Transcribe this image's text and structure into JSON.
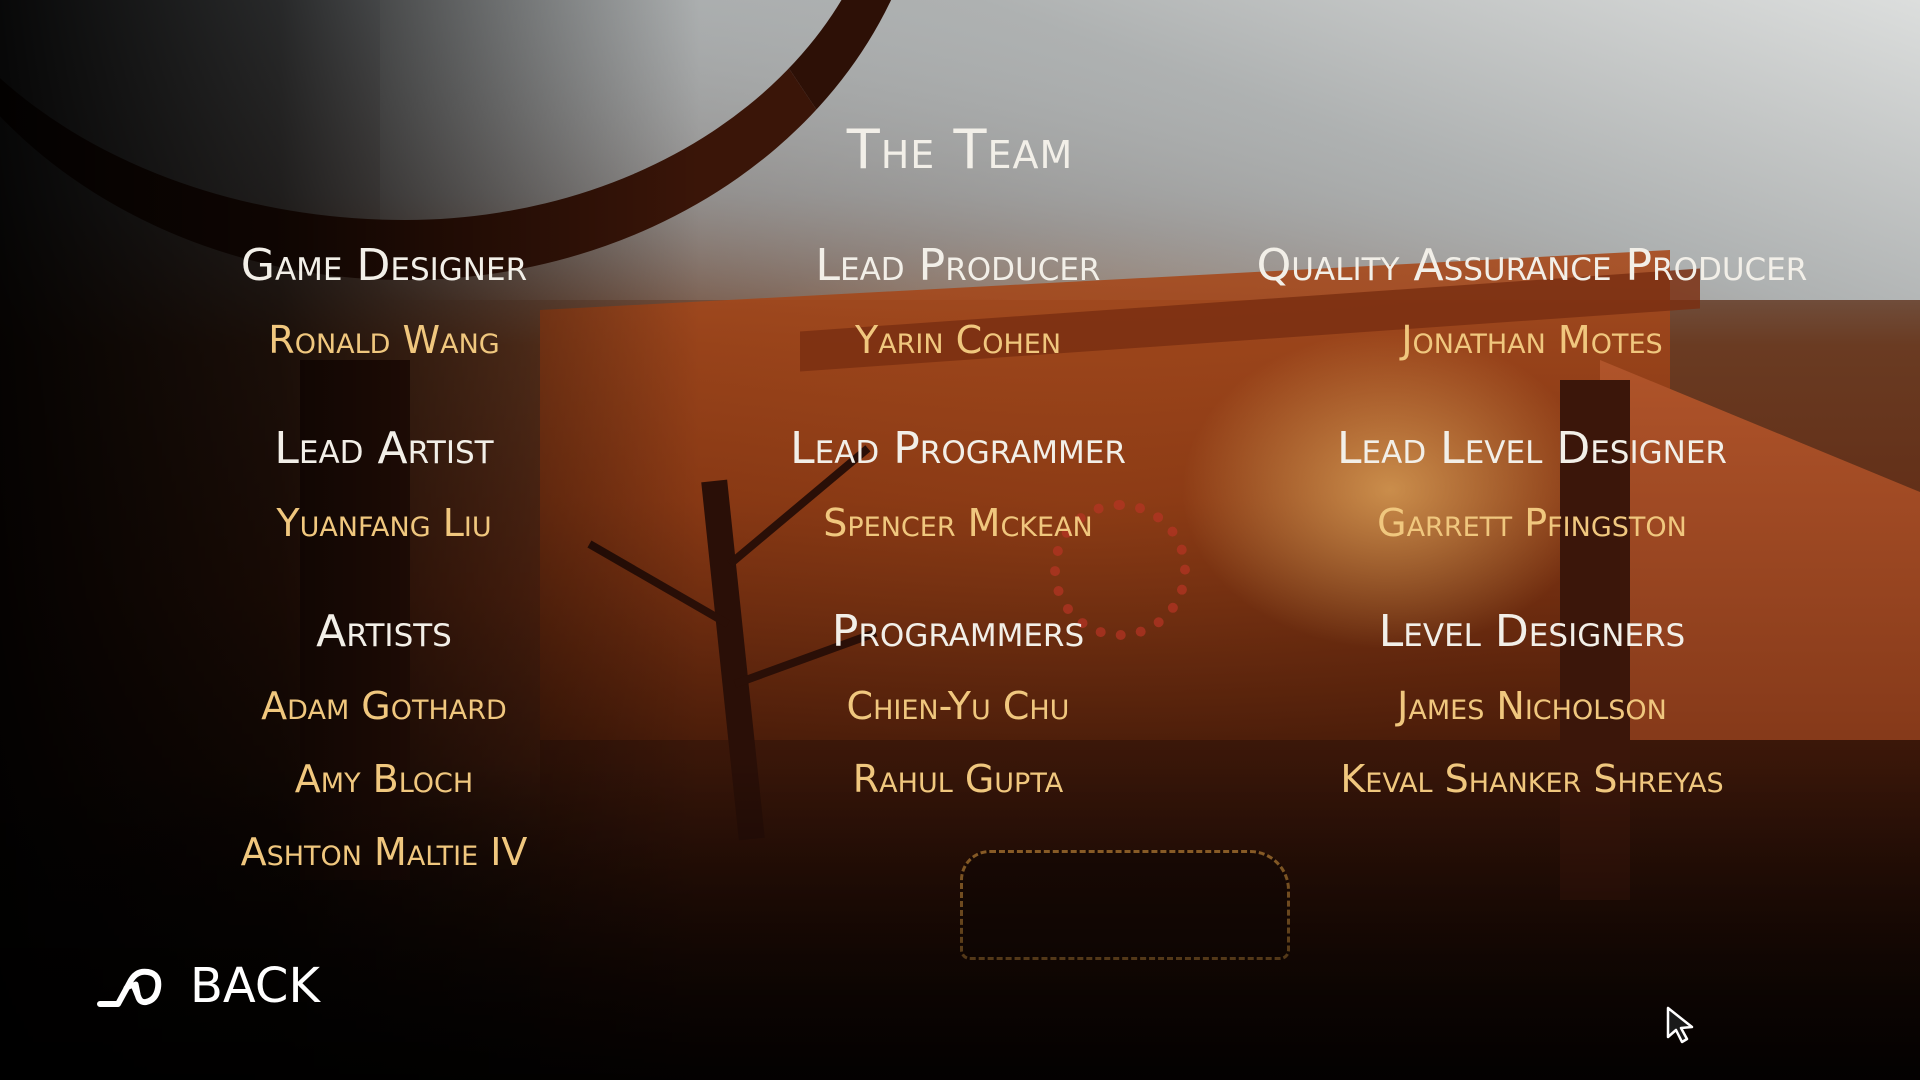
{
  "title": "The Team",
  "columns": [
    {
      "groups": [
        {
          "role": "Game Designer",
          "names": [
            "Ronald Wang"
          ]
        },
        {
          "role": "Lead Artist",
          "names": [
            "Yuanfang Liu"
          ]
        },
        {
          "role": "Artists",
          "names": [
            "Adam Gothard",
            "Amy Bloch",
            "Ashton Maltie IV"
          ]
        }
      ]
    },
    {
      "groups": [
        {
          "role": "Lead Producer",
          "names": [
            "Yarin Cohen"
          ]
        },
        {
          "role": "Lead Programmer",
          "names": [
            "Spencer Mckean"
          ]
        },
        {
          "role": "Programmers",
          "names": [
            "Chien-Yu Chu",
            "Rahul Gupta"
          ]
        }
      ]
    },
    {
      "groups": [
        {
          "role": "Quality Assurance Producer",
          "names": [
            "Jonathan Motes"
          ]
        },
        {
          "role": "Lead Level Designer",
          "names": [
            "Garrett Pfingston"
          ]
        },
        {
          "role": "Level Designers",
          "names": [
            "James Nicholson",
            "Keval Shanker Shreyas"
          ]
        }
      ]
    }
  ],
  "back": {
    "label": "BACK",
    "icon": "back-arrow-icon"
  },
  "cursor": {
    "icon": "mouse-cursor-icon"
  },
  "colors": {
    "heading": "#f2efe8",
    "name": "#f0c77e",
    "back": "#ffffff"
  }
}
